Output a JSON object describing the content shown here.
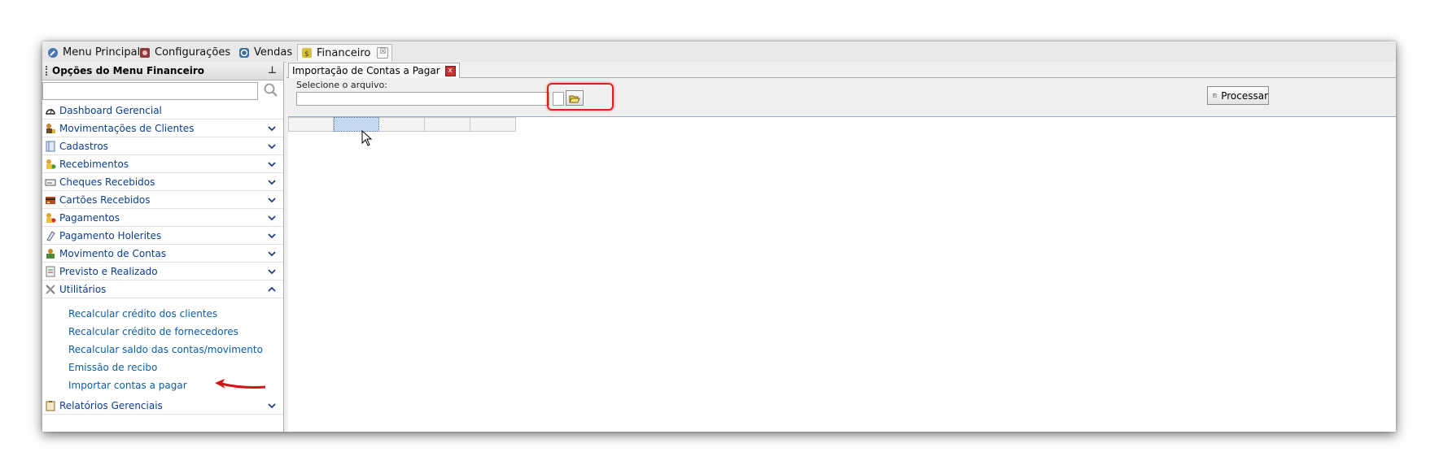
{
  "top_tabs": [
    {
      "label": "Menu Principal",
      "icon": "wrench-icon",
      "active": false
    },
    {
      "label": "Configurações",
      "icon": "settings-icon",
      "active": false
    },
    {
      "label": "Vendas",
      "icon": "sales-icon",
      "active": false
    },
    {
      "label": "Financeiro",
      "icon": "money-icon",
      "active": true,
      "close": "☒"
    }
  ],
  "left_panel": {
    "title": "Opções do Menu Financeiro",
    "pin_glyph": "⊥",
    "search_value": "",
    "menu_items": [
      {
        "label": "Dashboard Gerencial",
        "icon": "dashboard-icon",
        "expandable": false
      },
      {
        "label": "Movimentações de Clientes",
        "icon": "clients-icon",
        "expandable": true
      },
      {
        "label": "Cadastros",
        "icon": "book-icon",
        "expandable": true
      },
      {
        "label": "Recebimentos",
        "icon": "receive-icon",
        "expandable": true
      },
      {
        "label": "Cheques Recebidos",
        "icon": "cheque-icon",
        "expandable": true
      },
      {
        "label": "Cartões Recebidos",
        "icon": "card-icon",
        "expandable": true
      },
      {
        "label": "Pagamentos",
        "icon": "payment-icon",
        "expandable": true
      },
      {
        "label": "Pagamento Holerites",
        "icon": "paycheck-icon",
        "expandable": true
      },
      {
        "label": "Movimento de Contas",
        "icon": "accounts-icon",
        "expandable": true
      },
      {
        "label": "Previsto e Realizado",
        "icon": "forecast-icon",
        "expandable": true
      },
      {
        "label": "Utilitários",
        "icon": "tools-icon",
        "expandable": true,
        "expanded": true
      }
    ],
    "utilities_subitems": [
      "Recalcular crédito dos clientes",
      "Recalcular crédito de fornecedores",
      "Recalcular saldo das contas/movimento",
      "Emissão de recibo",
      "Importar contas a pagar"
    ],
    "last_item": {
      "label": "Relatórios Gerenciais",
      "icon": "report-icon",
      "expandable": true
    }
  },
  "document": {
    "tab_label": "Importação de Contas a Pagar",
    "close_glyph": "x",
    "file_label": "Selecione o arquivo:",
    "file_value": "",
    "process_label": "Processar"
  },
  "colors": {
    "accent_link": "#0b5cab",
    "menu_text": "#0b3d91",
    "highlight": "#e02020",
    "selection": "#c6d9f1"
  }
}
